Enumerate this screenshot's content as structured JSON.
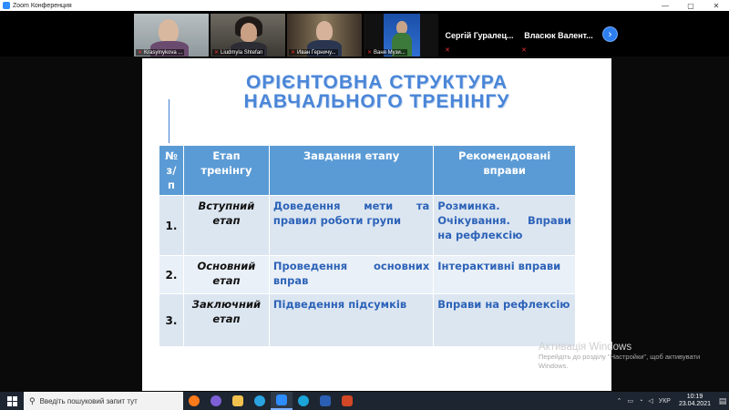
{
  "window": {
    "title": "Zoom Конференция",
    "minimize": "—",
    "maximize": "▢",
    "close": "✕"
  },
  "participants": [
    {
      "name": "Krasylnykova ...",
      "muted": true
    },
    {
      "name": "Liudmyla Shtefan",
      "muted": true
    },
    {
      "name": "Иван Герничу...",
      "muted": true
    },
    {
      "name": "Ваня Музи...",
      "muted": true
    },
    {
      "name": "Сергій Гуралец...",
      "muted": true
    },
    {
      "name": "Власюк Валент...",
      "muted": true
    }
  ],
  "next_page_icon": "›",
  "slide": {
    "title_line1": "ОРІЄНТОВНА СТРУКТУРА",
    "title_line2": "НАВЧАЛЬНОГО ТРЕНІНГУ",
    "table": {
      "headers": [
        "№ з/п",
        "Етап тренінгу",
        "Завдання етапу",
        "Рекомендовані вправи"
      ],
      "rows": [
        {
          "num": "1.",
          "stage": "Вступний етап",
          "task": "Доведення мети та правил роботи групи",
          "exercises": "Розминка. Очікування. Вправи на рефлексію"
        },
        {
          "num": "2.",
          "stage": "Основний етап",
          "task": "Проведення основних вправ",
          "exercises": "Інтерактивні вправи"
        },
        {
          "num": "3.",
          "stage": "Заключний етап",
          "task": "Підведення підсумків",
          "exercises": "Вправи на рефлексію"
        }
      ]
    }
  },
  "activation": {
    "line1": "Активація Windows",
    "line2": "Перейдіть до розділу \"Настройки\", щоб активувати Windows."
  },
  "taskbar": {
    "search_placeholder": "Введіть пошуковий запит тут",
    "apps": [
      {
        "icon": "firefox-icon",
        "color": "#ff7a1a"
      },
      {
        "icon": "viber-icon",
        "color": "#7d5fd6"
      },
      {
        "icon": "folder-icon",
        "color": "#f2c14e"
      },
      {
        "icon": "telegram-icon",
        "color": "#2aa3e0"
      },
      {
        "icon": "zoom-icon",
        "color": "#2d8cff"
      },
      {
        "icon": "edge-icon",
        "color": "#1ba5d8"
      },
      {
        "icon": "word-icon",
        "color": "#2b5fb4"
      },
      {
        "icon": "powerpoint-icon",
        "color": "#d24726"
      }
    ],
    "language": "УКР",
    "time": "10:19",
    "date": "23.04.2021"
  }
}
